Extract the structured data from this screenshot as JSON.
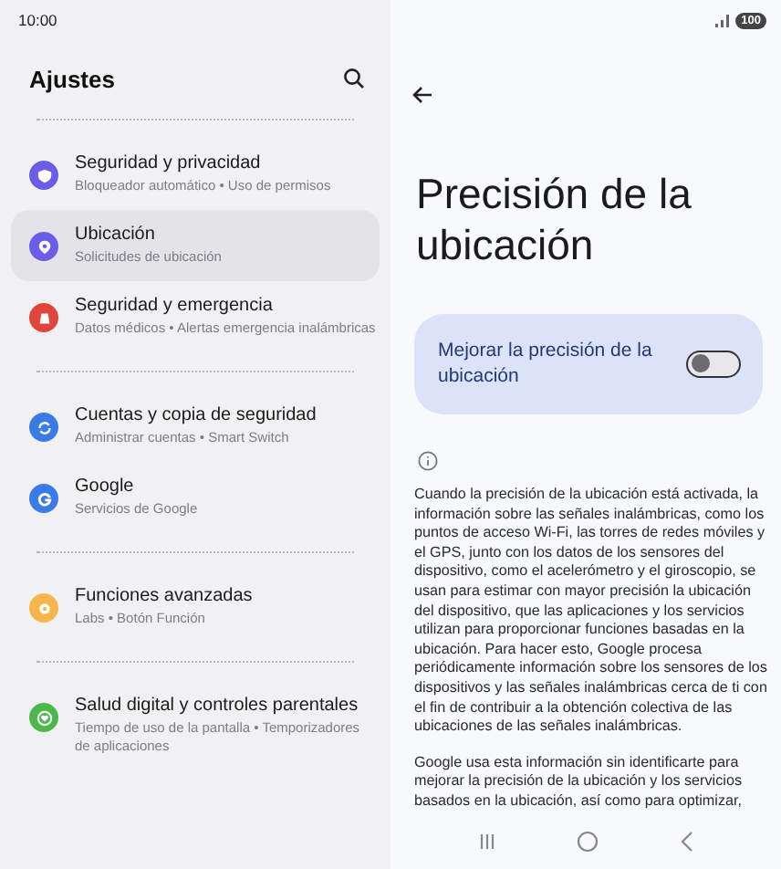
{
  "status_bar": {
    "time": "10:00",
    "battery": "100"
  },
  "settings": {
    "title": "Ajustes",
    "groups": [
      {
        "items": [
          {
            "title": "Seguridad y privacidad",
            "subtitle": "Bloqueador automático • Uso de permisos",
            "color": "#6a5ee8",
            "kind": "shield",
            "selected": false
          },
          {
            "title": "Ubicación",
            "subtitle": "Solicitudes de ubicación",
            "color": "#6a5ee8",
            "kind": "pin",
            "selected": true
          },
          {
            "title": "Seguridad y emergencia",
            "subtitle": "Datos médicos • Alertas emergencia inalámbricas",
            "color": "#e0443a",
            "kind": "siren",
            "selected": false
          }
        ]
      },
      {
        "items": [
          {
            "title": "Cuentas y copia de seguridad",
            "subtitle": "Administrar cuentas • Smart Switch",
            "color": "#3b7be8",
            "kind": "sync",
            "selected": false
          },
          {
            "title": "Google",
            "subtitle": "Servicios de Google",
            "color": "#3b7be8",
            "kind": "google",
            "selected": false
          }
        ]
      },
      {
        "items": [
          {
            "title": "Funciones avanzadas",
            "subtitle": "Labs • Botón Función",
            "color": "#f7b54a",
            "kind": "gear",
            "selected": false
          }
        ]
      },
      {
        "items": [
          {
            "title": "Salud digital y controles parentales",
            "subtitle": "Tiempo de uso de la pantalla • Temporizadores de aplicaciones",
            "color": "#4cb84a",
            "kind": "heart",
            "selected": false
          }
        ]
      }
    ]
  },
  "detail": {
    "title": "Precisión de la ubicación",
    "toggle": {
      "label": "Mejorar la precisión de la ubicación",
      "on": false
    },
    "paragraphs": [
      {
        "text": "Cuando la precisión de la ubicación está activada, la información sobre las señales inalámbricas, como los puntos de acceso Wi-Fi, las torres de redes móviles y el GPS, junto con los datos de los sensores del dispositivo, como el acelerómetro y el giroscopio, se usan para estimar con mayor precisión la ubicación del dispositivo, que las aplicaciones y los servicios utilizan para proporcionar funciones basadas en la ubicación. Para hacer esto, Google procesa periódicamente información sobre los sensores de los dispositivos y las señales inalámbricas cerca de ti con el fin de contribuir a la obtención colectiva de las ubicaciones de las señales inalámbricas."
      },
      {
        "text": "Google usa esta información sin identificarte para mejorar la precisión de la ubicación y los servicios basados en la ubicación, así como para optimizar,"
      }
    ]
  }
}
